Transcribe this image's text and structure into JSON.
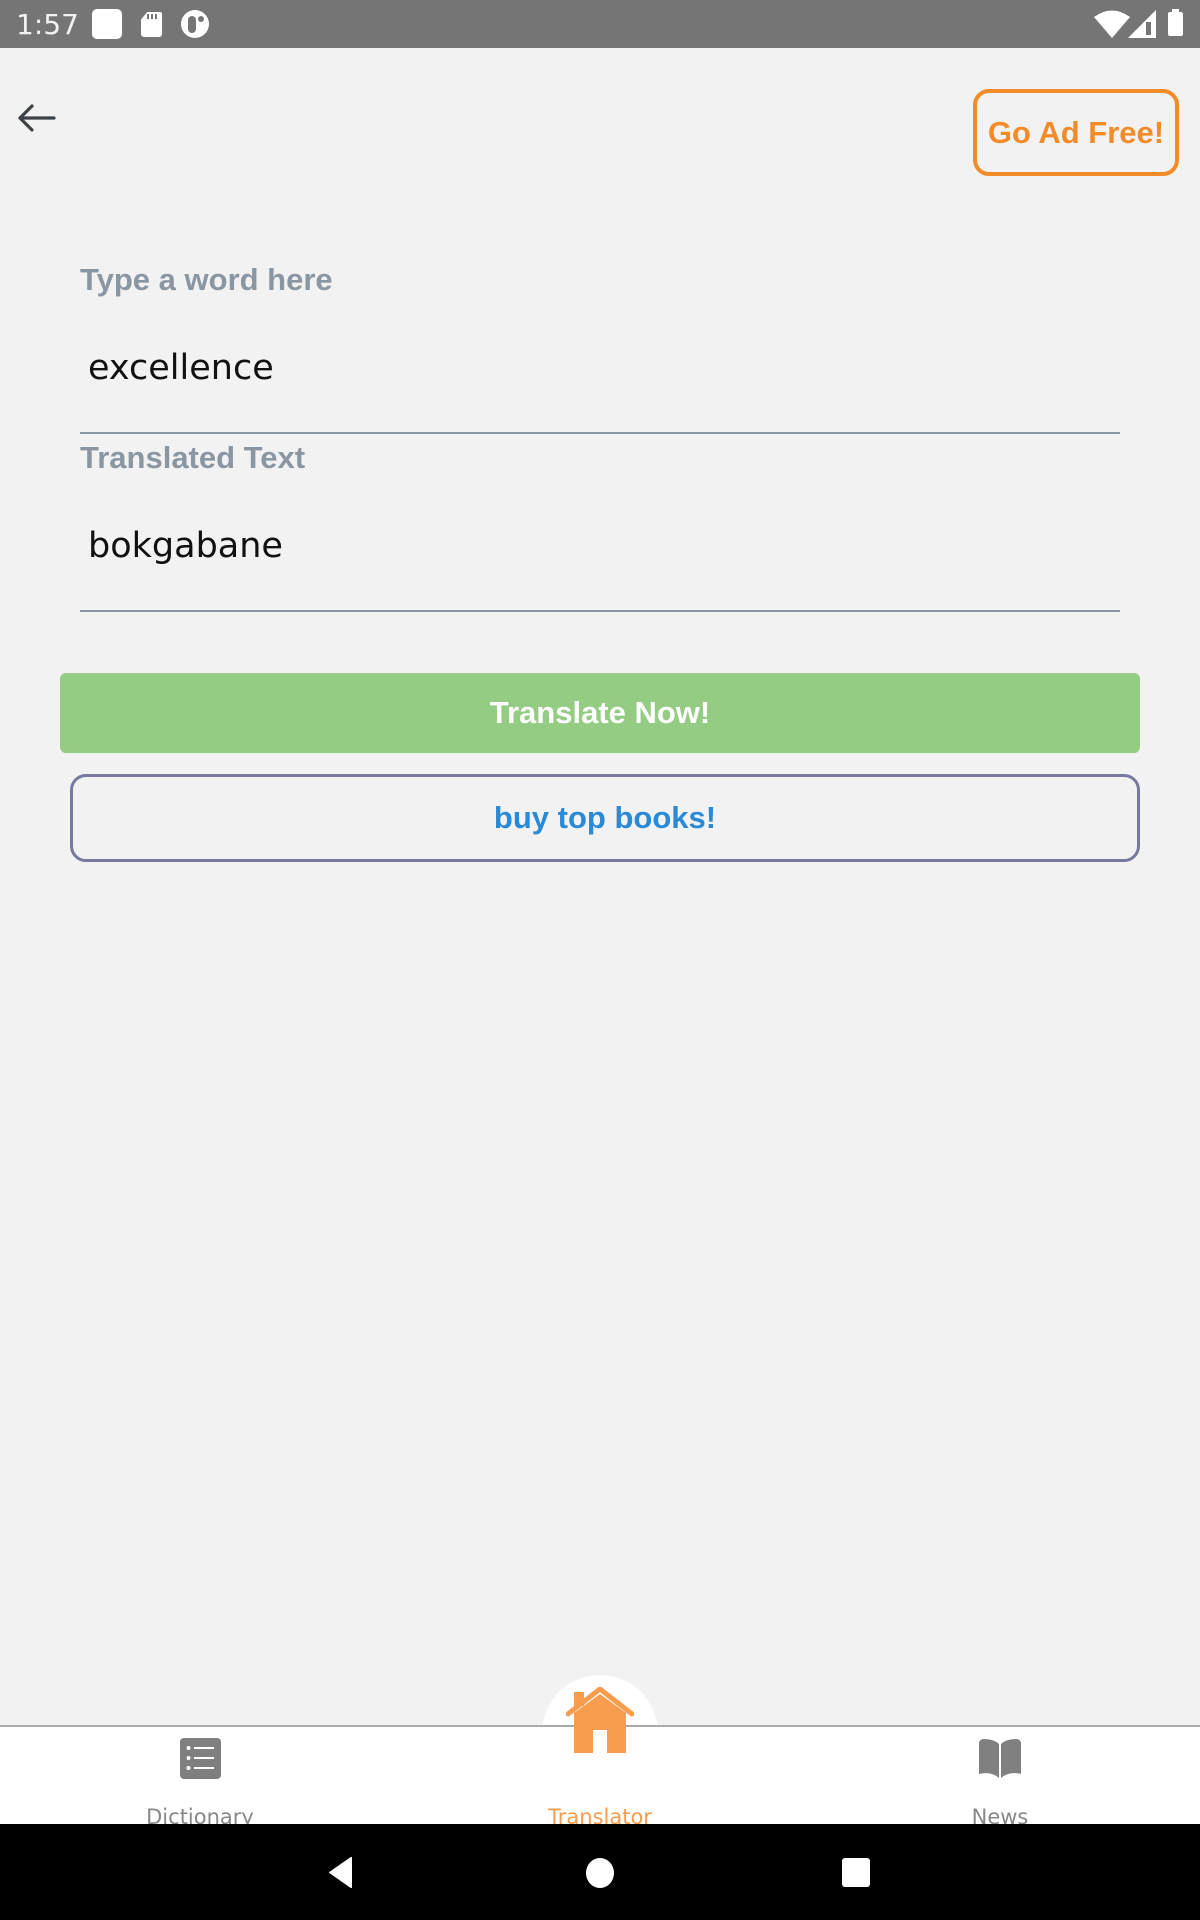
{
  "status_bar": {
    "time": "1:57",
    "left_icons": [
      "app-notification-icon",
      "sd-card-icon",
      "pocket-casts-icon"
    ],
    "right_icons": [
      "wifi-icon",
      "cellular-signal-icon",
      "battery-icon"
    ]
  },
  "header": {
    "back_icon": "arrow-left-icon",
    "ad_free_label": "Go Ad Free!"
  },
  "form": {
    "input_label": "Type a word here",
    "input_value": "excellence",
    "output_label": "Translated Text",
    "output_value": "bokgabane",
    "translate_label": "Translate Now!",
    "books_label": "buy top books!"
  },
  "bottom_nav": {
    "items": [
      {
        "label": "Dictionary",
        "icon": "list-icon",
        "active": false
      },
      {
        "label": "Translator",
        "icon": "home-icon",
        "active": true
      },
      {
        "label": "News",
        "icon": "book-open-icon",
        "active": false
      }
    ]
  },
  "system_nav": {
    "buttons": [
      "back-triangle-icon",
      "home-circle-icon",
      "recents-square-icon"
    ]
  },
  "colors": {
    "accent_orange": "#f28c28",
    "active_tab": "#f89c4e",
    "translate_green": "#94cc84",
    "books_text_blue": "#2a8ad6",
    "books_border": "#777a9e",
    "label_gray": "#8a96a2",
    "background": "#f2f2f2"
  }
}
